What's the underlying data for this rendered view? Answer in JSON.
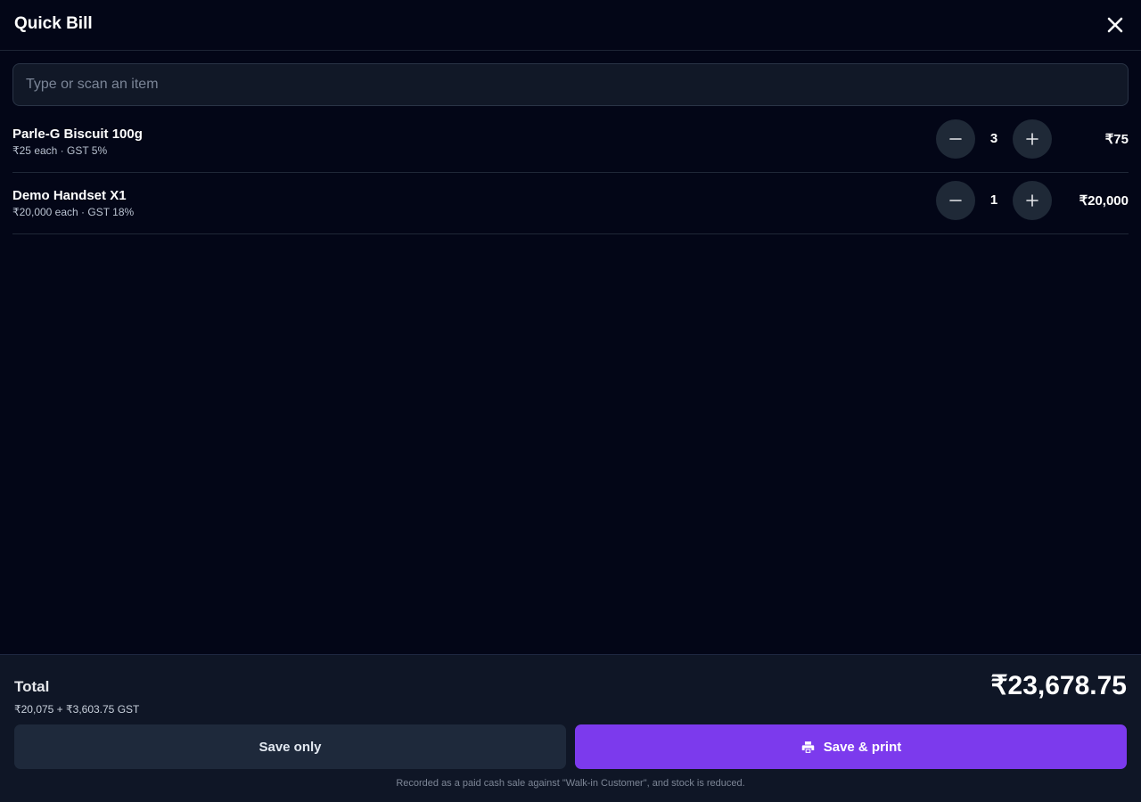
{
  "header": {
    "title": "Quick Bill",
    "close_icon": "close-icon"
  },
  "search": {
    "placeholder": "Type or scan an item",
    "value": ""
  },
  "items": [
    {
      "name": "Parle-G Biscuit 100g",
      "meta": "₹25 each · GST 5%",
      "qty": "3",
      "total": "₹75"
    },
    {
      "name": "Demo Handset X1",
      "meta": "₹20,000 each · GST 18%",
      "qty": "1",
      "total": "₹20,000"
    }
  ],
  "footer": {
    "total_label": "Total",
    "total_breakdown": "₹20,075 + ₹3,603.75 GST",
    "total_amount": "₹23,678.75",
    "save_only_label": "Save only",
    "save_print_label": "Save & print",
    "note": "Recorded as a paid cash sale against \"Walk-in Customer\", and stock is reduced."
  },
  "colors": {
    "background": "#030617",
    "footer_bg": "#0f1626",
    "accent": "#7c3aed",
    "qty_button_bg": "#1f2937"
  },
  "icons": {
    "minus": "minus-icon",
    "plus": "plus-icon",
    "printer": "printer-icon"
  }
}
